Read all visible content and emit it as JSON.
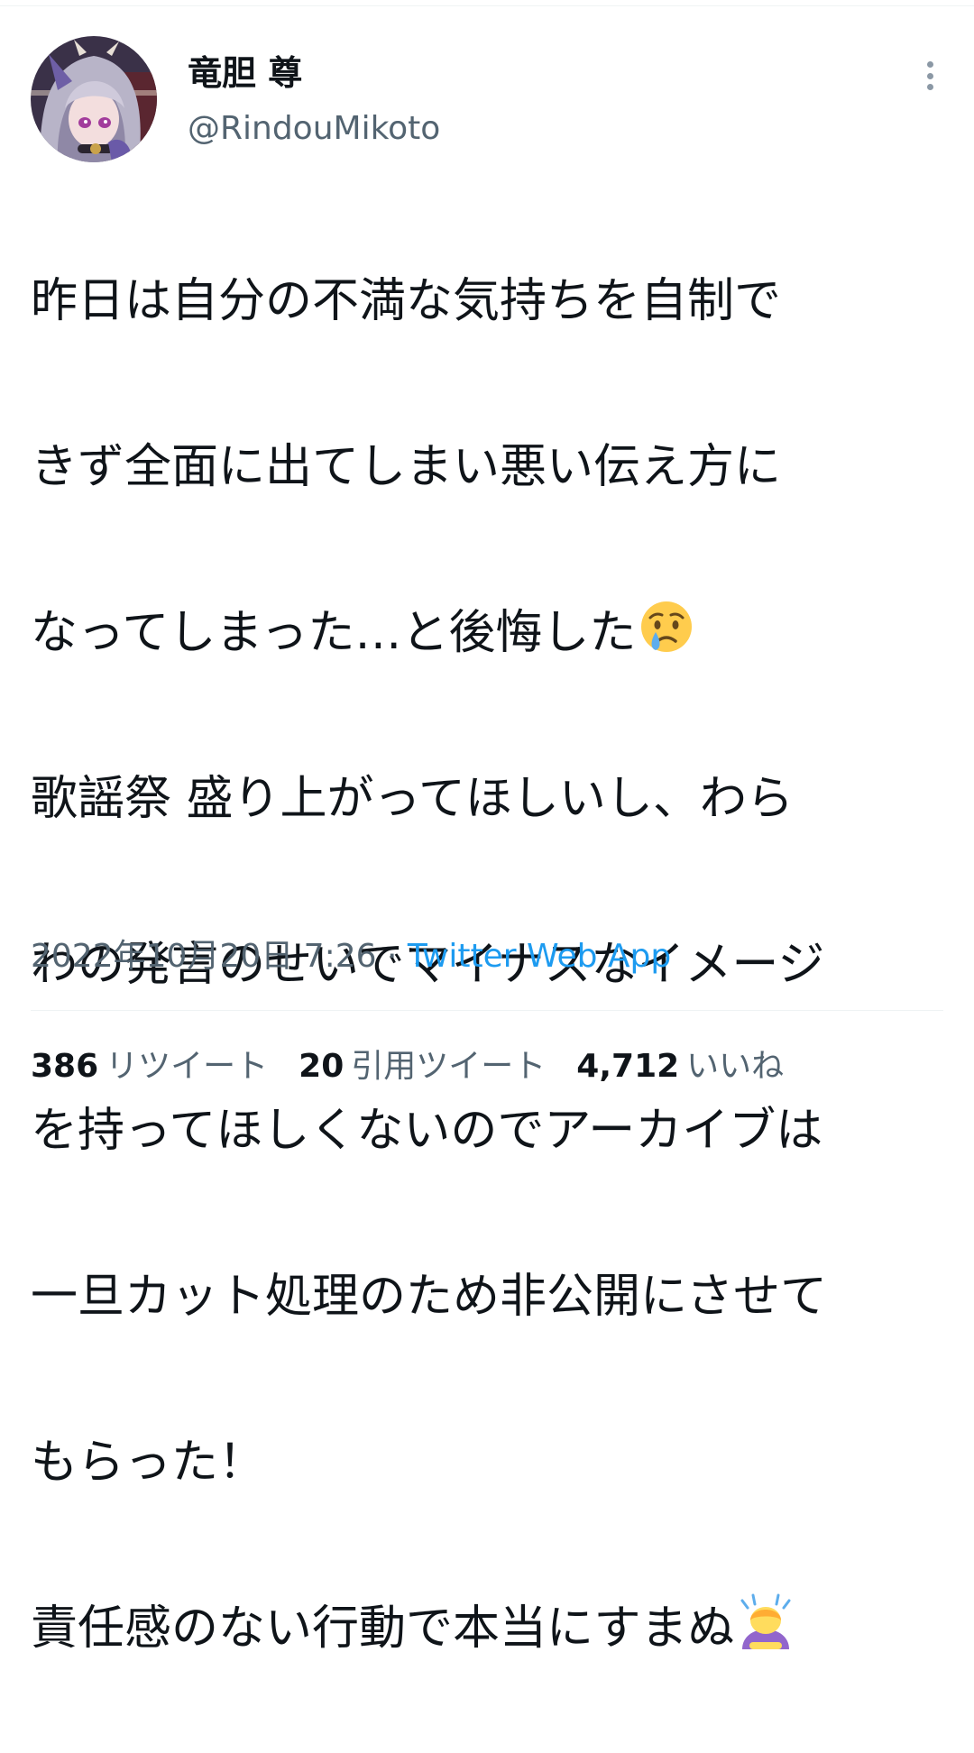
{
  "author": {
    "display_name": "竜胆 尊",
    "handle": "@RindouMikoto",
    "avatar_icon": "avatar-anime-girl-icon"
  },
  "tweet": {
    "lines": [
      "昨日は自分の不満な気持ちを自制で",
      "きず全面に出てしまい悪い伝え方に",
      "なってしまった…と後悔した",
      "歌謡祭 盛り上がってほしいし、わら",
      "わの発言のせいでマイナスなイメージ",
      "を持ってほしくないのでアーカイブは",
      "一旦カット処理のため非公開にさせて",
      "もらった！",
      "責任感のない行動で本当にすまぬ"
    ],
    "emoji_line_3": "crying-face-emoji",
    "emoji_line_9": "person-bowing-emoji"
  },
  "meta": {
    "timestamp": "2022年10月20日 7:26",
    "separator": " · ",
    "source": "Twitter Web App"
  },
  "stats": {
    "retweets_count": "386",
    "retweets_label": "リツイート",
    "quotes_count": "20",
    "quotes_label": "引用ツイート",
    "likes_count": "4,712",
    "likes_label": "いいね"
  },
  "colors": {
    "text": "#0f1419",
    "secondary": "#536471",
    "link": "#1d9bf0",
    "divider": "#eff3f4"
  }
}
